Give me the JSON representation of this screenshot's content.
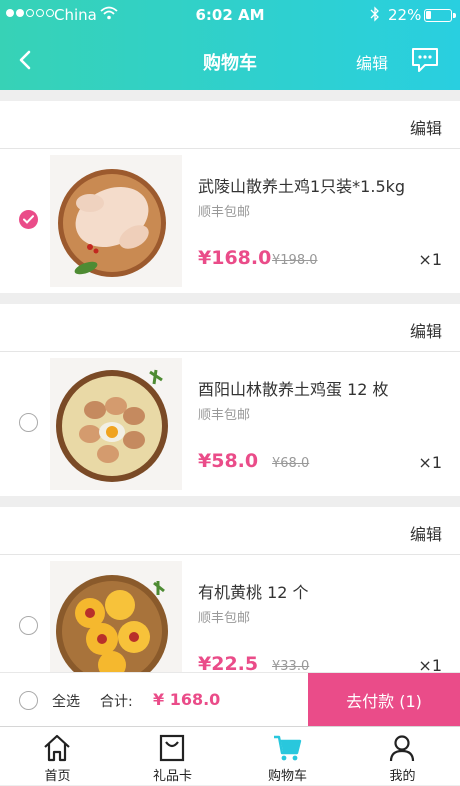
{
  "status_bar": {
    "carrier": "China",
    "time": "6:02 AM",
    "battery": "22%",
    "battery_level": 0.22
  },
  "header": {
    "title": "购物车",
    "edit_label": "编辑"
  },
  "cart": {
    "items": [
      {
        "edit_label": "编辑",
        "name": "武陵山散养土鸡1只装*1.5kg",
        "shipping": "顺丰包邮",
        "price": "¥168.0",
        "original_price": "¥198.0",
        "quantity": "×1",
        "selected": true
      },
      {
        "edit_label": "编辑",
        "name": "酉阳山林散养土鸡蛋 12 枚",
        "shipping": "顺丰包邮",
        "price": "¥58.0",
        "original_price": "¥68.0",
        "quantity": "×1",
        "selected": false
      },
      {
        "edit_label": "编辑",
        "name": "有机黄桃 12 个",
        "shipping": "顺丰包邮",
        "price": "¥22.5",
        "original_price": "¥33.0",
        "quantity": "×1",
        "selected": false
      }
    ]
  },
  "checkout": {
    "select_all_label": "全选",
    "total_label": "合计:",
    "total_amount": "¥ 168.0",
    "pay_button": "去付款 (1)"
  },
  "tabbar": {
    "tabs": [
      {
        "label": "首页",
        "icon": "home-icon"
      },
      {
        "label": "礼品卡",
        "icon": "gift-card-icon"
      },
      {
        "label": "购物车",
        "icon": "cart-icon",
        "active": true
      },
      {
        "label": "我的",
        "icon": "user-icon"
      }
    ]
  },
  "colors": {
    "header_start": "#37d2b6",
    "header_end": "#29cfe0",
    "accent": "#ea4c89",
    "active_tab": "#29c7dd"
  }
}
